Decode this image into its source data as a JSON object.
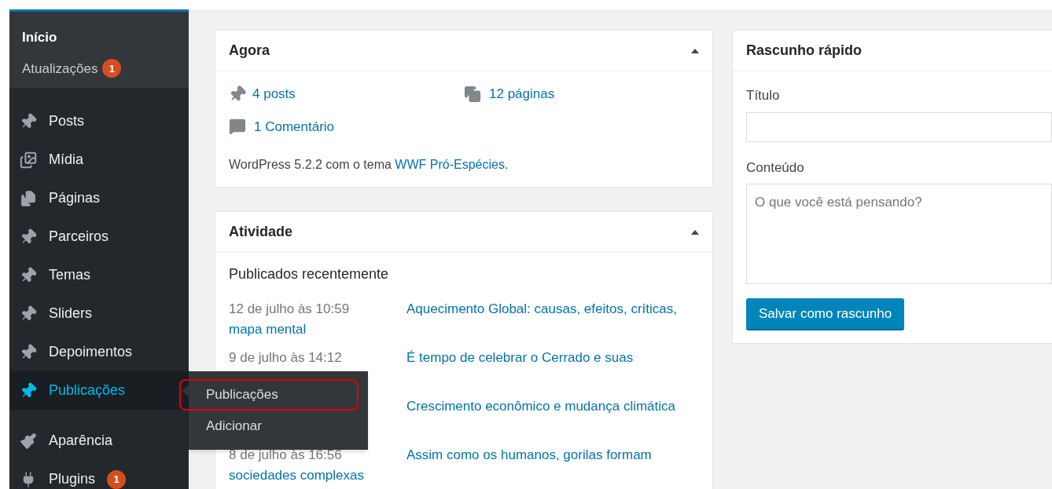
{
  "sidebar": {
    "home": {
      "label": "Início",
      "updates": {
        "label": "Atualizações",
        "badge": "1"
      }
    },
    "items": [
      {
        "label": "Posts",
        "kind": "pin",
        "selected": false
      },
      {
        "label": "Mídia",
        "kind": "media",
        "selected": false
      },
      {
        "label": "Páginas",
        "kind": "pages",
        "selected": false
      },
      {
        "label": "Parceiros",
        "kind": "pin",
        "selected": false
      },
      {
        "label": "Temas",
        "kind": "pin",
        "selected": false
      },
      {
        "label": "Sliders",
        "kind": "pin",
        "selected": false
      },
      {
        "label": "Depoimentos",
        "kind": "pin",
        "selected": false
      },
      {
        "label": "Publicações",
        "kind": "pin",
        "selected": true,
        "submenu": [
          {
            "label": "Publicações",
            "highlighted": true
          },
          {
            "label": "Adicionar",
            "highlighted": false
          }
        ]
      },
      {
        "label": "Aparência",
        "kind": "brush",
        "selected": false,
        "separated": true
      },
      {
        "label": "Plugins",
        "kind": "plug",
        "selected": false,
        "badge": "1"
      }
    ]
  },
  "glance": {
    "title": "Agora",
    "posts": "4 posts",
    "pages": "12 páginas",
    "comments": "1 Comentário",
    "version_text": "WordPress 5.2.2 com o tema ",
    "theme_link": "WWF Pró-Espécies",
    "version_end": "."
  },
  "activity": {
    "title": "Atividade",
    "subtitle": "Publicados recentemente",
    "rows": [
      {
        "date": "12 de julho às 10:59",
        "title": "Aquecimento Global: causas, efeitos, críticas,",
        "title_rest": "mapa mental"
      },
      {
        "date": "9 de julho às 14:12",
        "title": "É tempo de celebrar o Cerrado e suas"
      },
      {
        "title": "Crescimento econômico e mudança climática"
      },
      {
        "date": "8 de julho às 16:56",
        "title": "Assim como os humanos, gorilas formam",
        "title_rest": "sociedades complexas"
      }
    ]
  },
  "quick_draft": {
    "title": "Rascunho rápido",
    "title_label": "Título",
    "content_label": "Conteúdo",
    "content_placeholder": "O que você está pensando?",
    "button": "Salvar como rascunho"
  }
}
